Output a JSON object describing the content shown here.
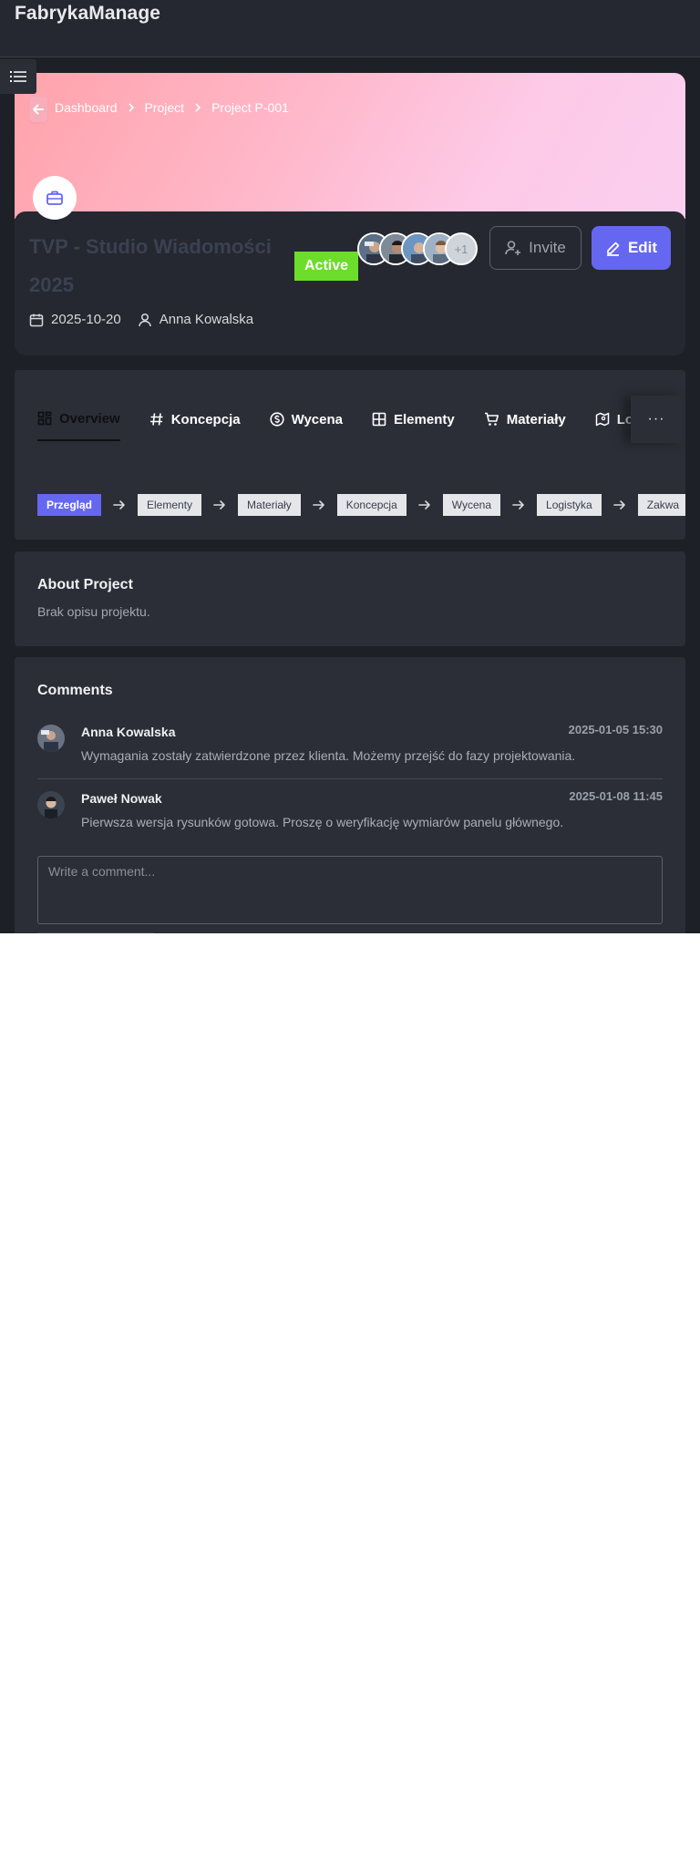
{
  "app": {
    "brand": "FabrykaManage"
  },
  "breadcrumb": [
    "Dashboard",
    "Project",
    "Project P-001"
  ],
  "project": {
    "title": "TVP - Studio Wiadomości 2025",
    "date": "2025-10-20",
    "owner": "Anna Kowalska",
    "status": "Active",
    "extra_members": "+1"
  },
  "actions": {
    "invite": "Invite",
    "edit": "Edit"
  },
  "tabs": [
    {
      "label": "Overview",
      "icon": "grid-icon"
    },
    {
      "label": "Koncepcja",
      "icon": "hash-icon"
    },
    {
      "label": "Wycena",
      "icon": "dollar-circle-icon"
    },
    {
      "label": "Elementy",
      "icon": "table-icon"
    },
    {
      "label": "Materiały",
      "icon": "cart-icon"
    },
    {
      "label": "Lo",
      "icon": "map-icon"
    }
  ],
  "more_label": "···",
  "workflow": [
    "Przegląd",
    "Elementy",
    "Materiały",
    "Koncepcja",
    "Wycena",
    "Logistyka",
    "Zakwa"
  ],
  "about": {
    "title": "About Project",
    "text": "Brak opisu projektu."
  },
  "comments": {
    "title": "Comments",
    "items": [
      {
        "author": "Anna Kowalska",
        "time": "2025-01-05 15:30",
        "text": "Wymagania zostały zatwierdzone przez klienta. Możemy przejść do fazy projektowania."
      },
      {
        "author": "Paweł Nowak",
        "time": "2025-01-08 11:45",
        "text": "Pierwsza wersja rysunków gotowa. Proszę o weryfikację wymiarów panelu głównego."
      }
    ],
    "placeholder": "Write a comment..."
  },
  "colors": {
    "accent": "#6667f0",
    "status_active": "#6cdd2a",
    "background": "#1d2026",
    "card": "#2b2e36"
  }
}
